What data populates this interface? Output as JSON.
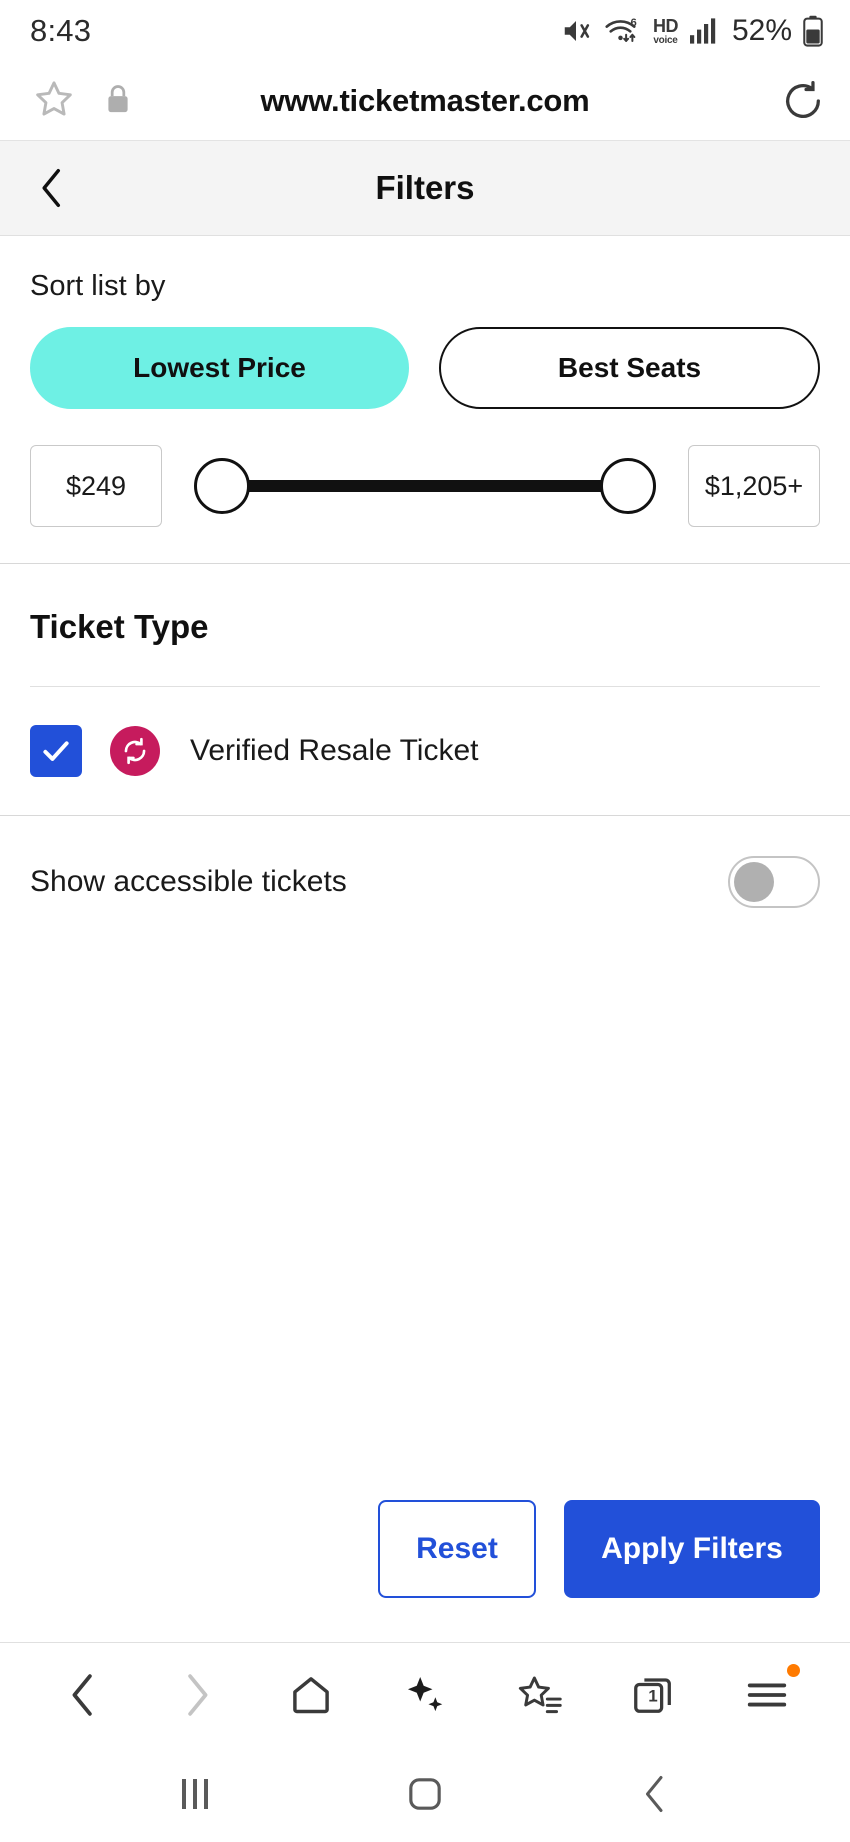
{
  "status_bar": {
    "time": "8:43",
    "battery_percent": "52%",
    "hd_label": "HD",
    "voice_label": "voice",
    "wifi_generation": "6",
    "icons": [
      "mute-icon",
      "wifi-icon",
      "hd-voice-icon",
      "cellular-signal-icon",
      "battery-icon"
    ]
  },
  "browser": {
    "url": "www.ticketmaster.com",
    "star_icon": "star-icon",
    "lock_icon": "lock-icon",
    "reload_icon": "reload-icon",
    "bottom_nav": {
      "back": "back-chevron-icon",
      "forward": "forward-chevron-icon",
      "home": "home-icon",
      "ai": "sparkle-icon",
      "bookmarks": "bookmark-star-icon",
      "tabs": "tabs-icon",
      "tab_count": "1",
      "menu": "hamburger-menu-icon"
    }
  },
  "system_nav": {
    "recents": "recents-icon",
    "home": "home-circle-icon",
    "back": "back-icon"
  },
  "page": {
    "header": {
      "title": "Filters",
      "back_icon": "back-chevron-icon"
    },
    "sort": {
      "label": "Sort list by",
      "options": [
        {
          "label": "Lowest Price",
          "selected": true
        },
        {
          "label": "Best Seats",
          "selected": false
        }
      ]
    },
    "price_range": {
      "min_value": "$249",
      "max_value": "$1,205+"
    },
    "ticket_type": {
      "title": "Ticket Type",
      "items": [
        {
          "label": "Verified Resale Ticket",
          "checked": true,
          "badge_icon": "resale-refresh-icon"
        }
      ]
    },
    "accessible": {
      "label": "Show accessible tickets",
      "enabled": false
    },
    "actions": {
      "reset_label": "Reset",
      "apply_label": "Apply Filters"
    }
  },
  "colors": {
    "accent_teal": "#6ef0e4",
    "primary_blue": "#2250d9",
    "resale_pink": "#c61b5d",
    "header_bg": "#f4f4f4",
    "notification_dot": "#ff7a00"
  }
}
